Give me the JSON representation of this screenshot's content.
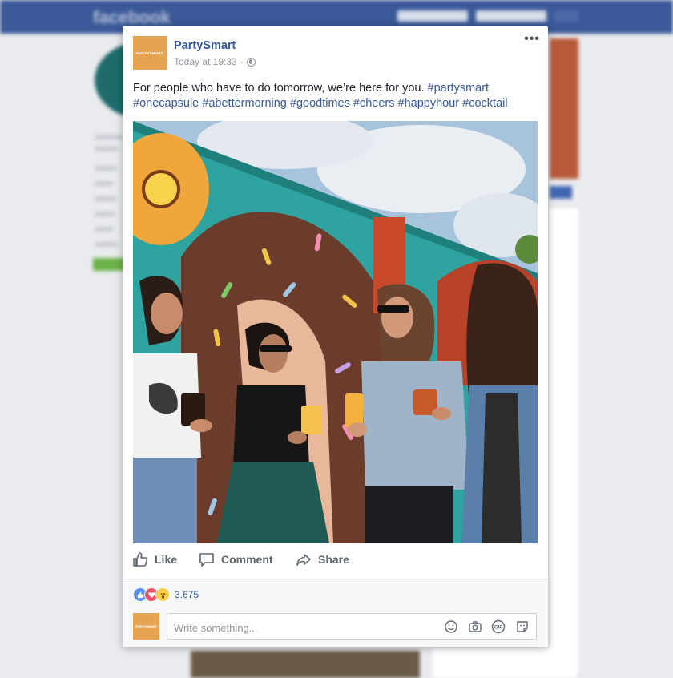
{
  "background": {
    "logo": "facebook"
  },
  "post": {
    "page_name": "PartySmart",
    "avatar_label": "PARTYSMART",
    "timestamp": "Today at 19:33",
    "privacy_separator": "·",
    "more_label": "•••",
    "text": {
      "body": "For people who have to do tomorrow, we’re here for you.",
      "hashtags": [
        "#partysmart",
        "#onecapsule",
        "#abettermorning",
        "#goodtimes",
        "#cheers",
        "#happyhour",
        "#cocktail"
      ]
    },
    "image_caption": "",
    "actions": {
      "like": "Like",
      "comment": "Comment",
      "share": "Share"
    },
    "reactions": {
      "types": [
        "like",
        "love",
        "wow"
      ],
      "count": "3.675"
    },
    "composer": {
      "placeholder": "Write something...",
      "icons": [
        "emoji-icon",
        "camera-icon",
        "gif-icon",
        "sticker-icon"
      ],
      "gif_label": "GIF"
    }
  },
  "colors": {
    "fb_blue": "#3b5998",
    "link_blue": "#365899",
    "brand_orange": "#e6a452"
  }
}
